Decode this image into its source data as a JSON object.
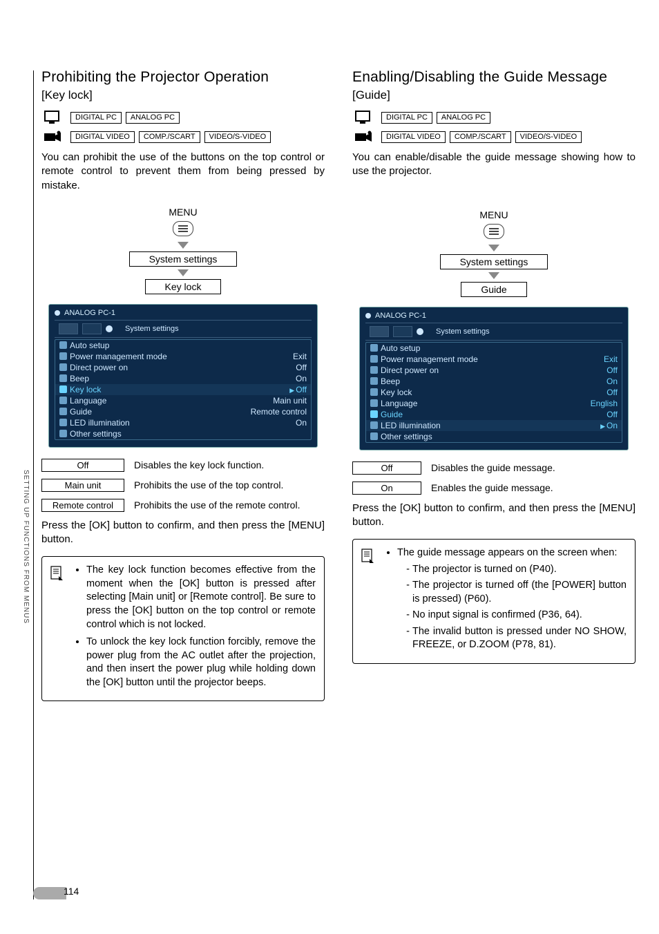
{
  "page_number": "114",
  "side_label": "SETTING UP FUNCTIONS FROM MENUS",
  "badges": {
    "d_pc": "DIGITAL PC",
    "a_pc": "ANALOG PC",
    "d_vid": "DIGITAL VIDEO",
    "comp": "COMP./SCART",
    "svid": "VIDEO/S-VIDEO"
  },
  "flow": {
    "menu": "MENU",
    "system": "System settings",
    "keylock": "Key lock",
    "guide": "Guide"
  },
  "osd": {
    "header": "ANALOG PC-1",
    "tab_title": "System settings",
    "items": [
      {
        "icon": "A",
        "label": "Auto setup",
        "value": ""
      },
      {
        "icon": "p",
        "label": "Power management mode",
        "value": "Exit"
      },
      {
        "icon": "d",
        "label": "Direct power on",
        "value": "Off"
      },
      {
        "icon": "b",
        "label": "Beep",
        "value": "On"
      },
      {
        "icon": "k",
        "label": "Key lock",
        "value": "Off"
      },
      {
        "icon": "l",
        "label": "Language",
        "value": "Main unit"
      },
      {
        "icon": "g",
        "label": "Guide",
        "value": "Remote control"
      },
      {
        "icon": "L",
        "label": "LED illumination",
        "value": "On"
      },
      {
        "icon": "o",
        "label": "Other settings",
        "value": ""
      }
    ],
    "items_right": [
      {
        "icon": "A",
        "label": "Auto setup",
        "value": ""
      },
      {
        "icon": "p",
        "label": "Power management mode",
        "value": "Exit"
      },
      {
        "icon": "d",
        "label": "Direct power on",
        "value": "Off"
      },
      {
        "icon": "b",
        "label": "Beep",
        "value": "On"
      },
      {
        "icon": "k",
        "label": "Key lock",
        "value": "Off"
      },
      {
        "icon": "l",
        "label": "Language",
        "value": "English"
      },
      {
        "icon": "g",
        "label": "Guide",
        "value": "Off"
      },
      {
        "icon": "L",
        "label": "LED illumination",
        "value": "On"
      },
      {
        "icon": "o",
        "label": "Other settings",
        "value": ""
      }
    ]
  },
  "left": {
    "title": "Prohibiting the Projector Operation",
    "subtitle": "[Key lock]",
    "intro": "You can prohibit the use of the buttons on the top control or remote control to prevent them from being pressed by mistake.",
    "opts": [
      {
        "k": "Off",
        "v": "Disables the key lock function."
      },
      {
        "k": "Main unit",
        "v": "Prohibits the use of the top control."
      },
      {
        "k": "Remote control",
        "v": "Prohibits the use of the remote control."
      }
    ],
    "press": "Press the [OK] button to confirm, and then press the [MENU] button.",
    "notes": [
      "The key lock function becomes effective from the moment when the [OK] button is pressed after selecting [Main unit] or [Remote control]. Be sure to press the [OK] button on the top control or remote control which is not locked.",
      "To unlock the key lock function forcibly, remove the power plug from the AC outlet after the projection, and then insert the power plug while holding down the [OK] button until the projector beeps."
    ]
  },
  "right": {
    "title": "Enabling/Disabling the Guide Message",
    "subtitle": "[Guide]",
    "intro": "You can enable/disable the guide message showing how to use the projector.",
    "opts": [
      {
        "k": "Off",
        "v": "Disables the guide message."
      },
      {
        "k": "On",
        "v": "Enables the guide message."
      }
    ],
    "press": "Press the [OK] button to confirm, and then press the [MENU] button.",
    "note_lead": "The guide message appears on the screen when:",
    "note_items": [
      "The projector is turned on (P40).",
      "The projector is turned off (the [POWER] button is pressed) (P60).",
      "No input signal is confirmed (P36, 64).",
      "The invalid button is pressed under NO SHOW, FREEZE, or D.ZOOM (P78, 81)."
    ]
  }
}
